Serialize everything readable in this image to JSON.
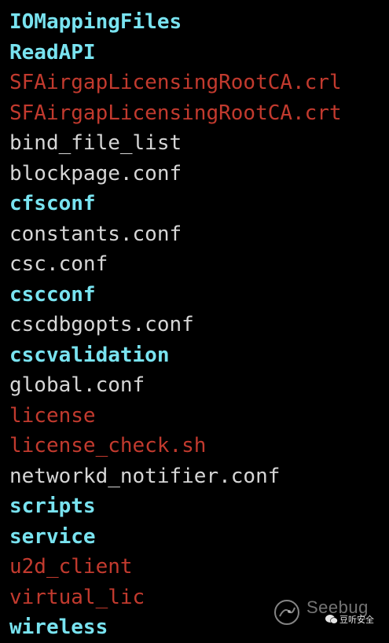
{
  "terminal": {
    "colors": {
      "background": "#000000",
      "directory": "#79E3F0",
      "executable": "#C23A2E",
      "file": "#D6D6D6"
    },
    "entries": [
      {
        "name": "IOMappingFiles",
        "kind": "directory"
      },
      {
        "name": "ReadAPI",
        "kind": "directory"
      },
      {
        "name": "SFAirgapLicensingRootCA.crl",
        "kind": "executable"
      },
      {
        "name": "SFAirgapLicensingRootCA.crt",
        "kind": "executable"
      },
      {
        "name": "bind_file_list",
        "kind": "file"
      },
      {
        "name": "blockpage.conf",
        "kind": "file"
      },
      {
        "name": "cfsconf",
        "kind": "directory"
      },
      {
        "name": "constants.conf",
        "kind": "file"
      },
      {
        "name": "csc.conf",
        "kind": "file"
      },
      {
        "name": "cscconf",
        "kind": "directory"
      },
      {
        "name": "cscdbgopts.conf",
        "kind": "file"
      },
      {
        "name": "cscvalidation",
        "kind": "directory"
      },
      {
        "name": "global.conf",
        "kind": "file"
      },
      {
        "name": "license",
        "kind": "executable"
      },
      {
        "name": "license_check.sh",
        "kind": "executable"
      },
      {
        "name": "networkd_notifier.conf",
        "kind": "file"
      },
      {
        "name": "scripts",
        "kind": "directory"
      },
      {
        "name": "service",
        "kind": "directory"
      },
      {
        "name": "u2d_client",
        "kind": "executable"
      },
      {
        "name": "virtual_lic",
        "kind": "executable"
      },
      {
        "name": "wireless",
        "kind": "directory"
      }
    ]
  },
  "watermark": {
    "brand": "Seebug",
    "sub": "豆听安全",
    "icon": "seebug-logo-icon",
    "chat_icon": "wechat-bubble-icon"
  }
}
